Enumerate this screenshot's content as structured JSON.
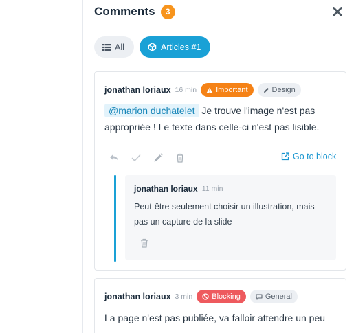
{
  "header": {
    "title": "Comments",
    "count": "3"
  },
  "filters": {
    "all_label": "All",
    "articles_label": "Articles #1"
  },
  "comments": [
    {
      "author": "jonathan loriaux",
      "time": "16 min",
      "priority": "Important",
      "category": "Design",
      "mention": "@marion duchatelet",
      "text": " Je trouve l'image n'est pas appropriée ! Le texte dans celle-ci n'est pas lisible.",
      "goto_label": "Go to block",
      "reply": {
        "author": "jonathan loriaux",
        "time": "11 min",
        "text": "Peut-être seulement choisir un illustration, mais pas un capture de la slide"
      }
    },
    {
      "author": "jonathan loriaux",
      "time": "3 min",
      "priority": "Blocking",
      "category": "General",
      "text": "La page n'est pas publiée, va falloir attendre un peu"
    }
  ],
  "colors": {
    "accent": "#1aa1d6",
    "badge": "#f7941d",
    "important": "#f58216",
    "blocking": "#ee5a5e"
  },
  "icons": [
    "list-icon",
    "cube-icon",
    "close-icon",
    "warning-icon",
    "pencil-icon",
    "reply-icon",
    "check-icon",
    "edit-icon",
    "trash-icon",
    "external-link-icon",
    "ban-icon",
    "comment-icon"
  ]
}
